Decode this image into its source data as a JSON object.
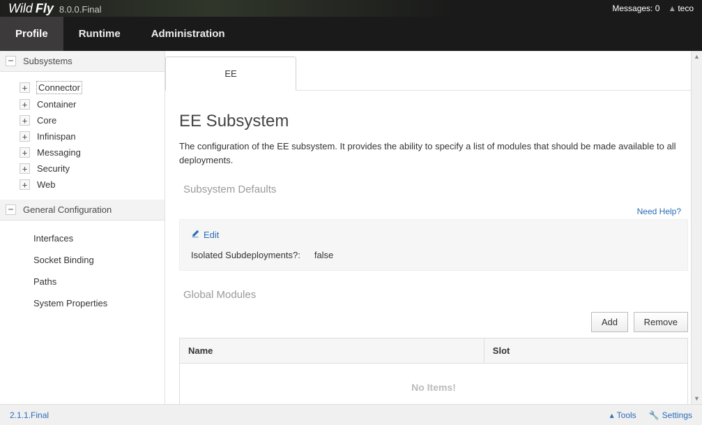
{
  "header": {
    "logo_wild": "Wild",
    "logo_fly": "Fly",
    "version": "8.0.0.Final",
    "messages_label": "Messages:",
    "messages_count": "0",
    "username": "teco"
  },
  "nav": {
    "tabs": [
      {
        "label": "Profile",
        "active": true
      },
      {
        "label": "Runtime",
        "active": false
      },
      {
        "label": "Administration",
        "active": false
      }
    ]
  },
  "sidebar": {
    "groups": [
      {
        "title": "Subsystems",
        "expanded": true,
        "tree": true,
        "items": [
          {
            "label": "Connector",
            "selected": true
          },
          {
            "label": "Container"
          },
          {
            "label": "Core"
          },
          {
            "label": "Infinispan"
          },
          {
            "label": "Messaging"
          },
          {
            "label": "Security"
          },
          {
            "label": "Web"
          }
        ]
      },
      {
        "title": "General Configuration",
        "expanded": true,
        "tree": false,
        "items": [
          {
            "label": "Interfaces"
          },
          {
            "label": "Socket Binding"
          },
          {
            "label": "Paths"
          },
          {
            "label": "System Properties"
          }
        ]
      }
    ]
  },
  "content": {
    "tab_label": "EE",
    "title": "EE Subsystem",
    "description": "The configuration of the EE subsystem. It provides the ability to specify a list of modules that should be made available to all deployments.",
    "section1_label": "Subsystem Defaults",
    "help_link": "Need Help?",
    "edit_label": "Edit",
    "form": {
      "label": "Isolated Subdeployments?:",
      "value": "false"
    },
    "section2_label": "Global Modules",
    "add_btn": "Add",
    "remove_btn": "Remove",
    "table": {
      "col_name": "Name",
      "col_slot": "Slot",
      "no_items": "No Items!"
    }
  },
  "footer": {
    "version": "2.1.1.Final",
    "tools": "Tools",
    "settings": "Settings"
  }
}
